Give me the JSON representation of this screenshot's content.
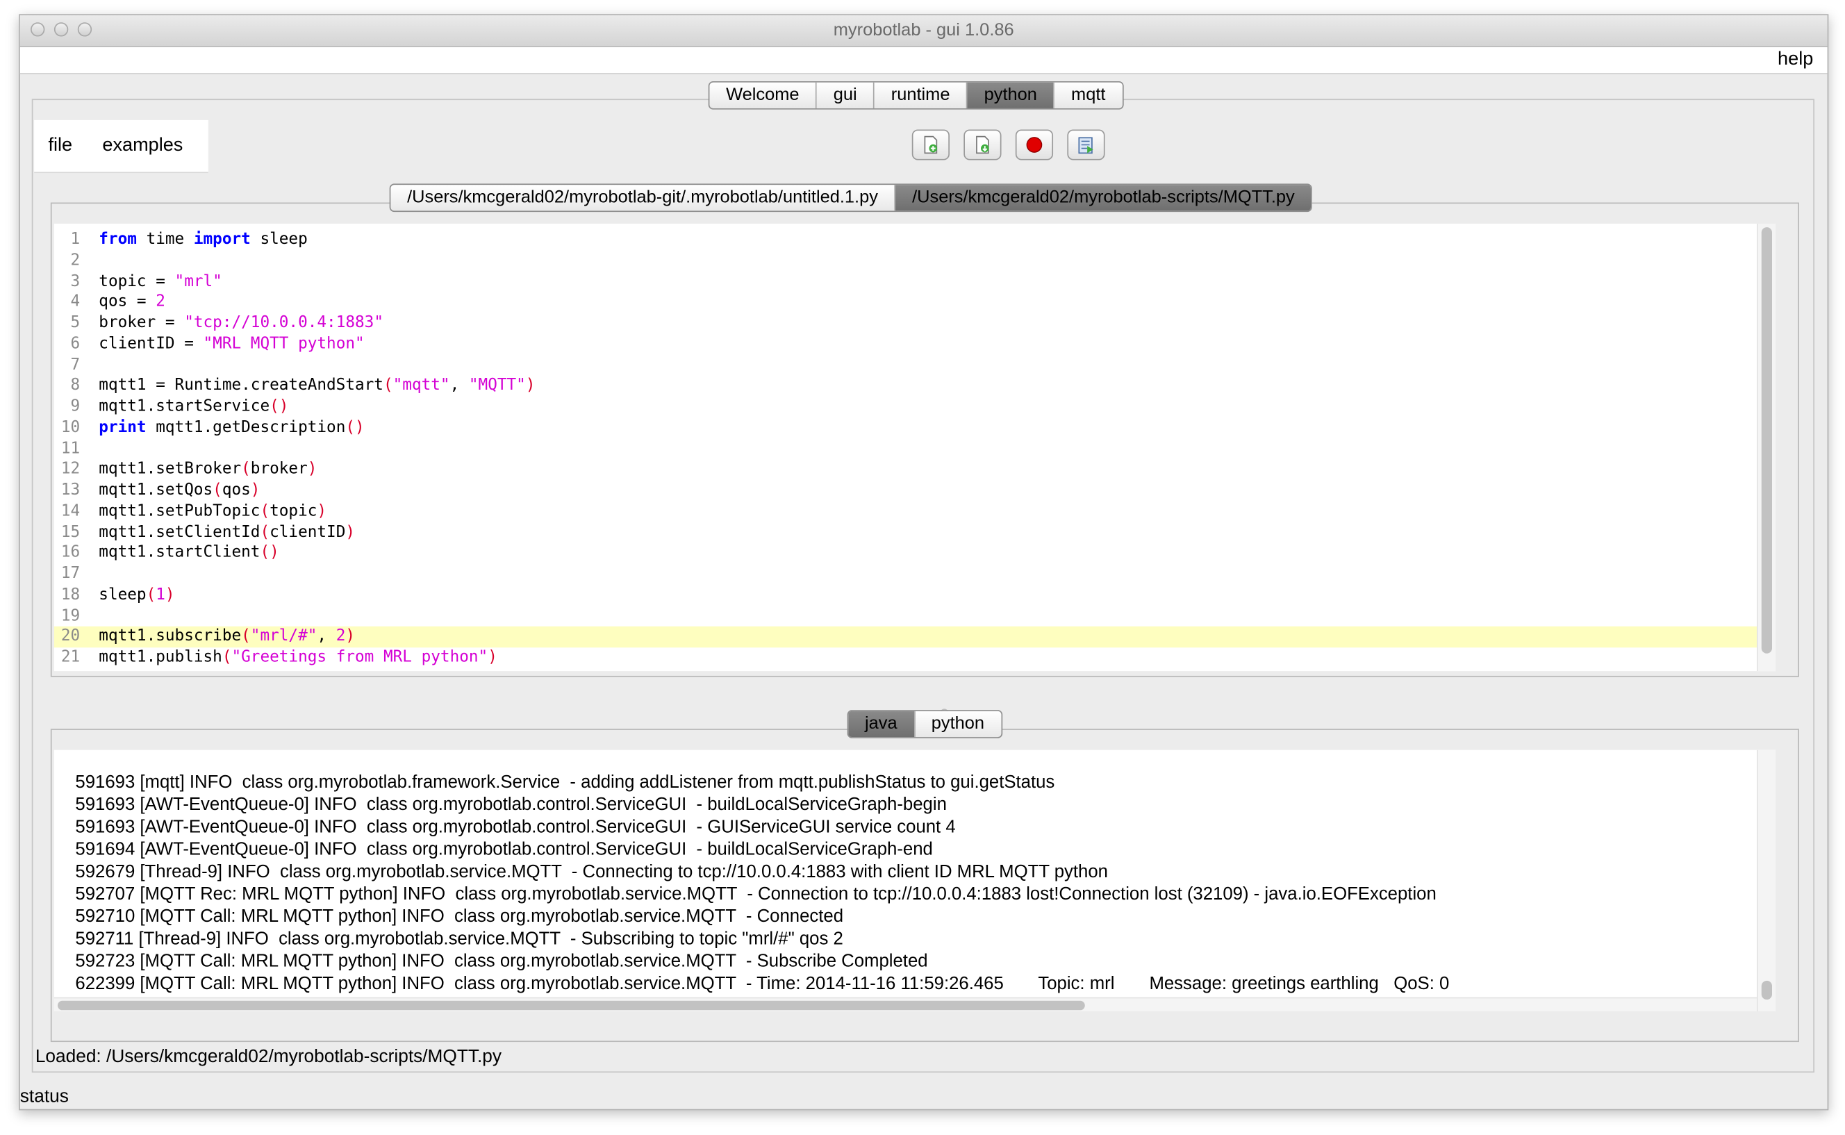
{
  "window": {
    "title": "myrobotlab - gui 1.0.86"
  },
  "menubar": {
    "help": "help"
  },
  "main_tabs": [
    {
      "label": "Welcome",
      "selected": false
    },
    {
      "label": "gui",
      "selected": false
    },
    {
      "label": "runtime",
      "selected": false
    },
    {
      "label": "python",
      "selected": true
    },
    {
      "label": "mqtt",
      "selected": false
    }
  ],
  "python_menu": {
    "file": "file",
    "examples": "examples"
  },
  "toolbar": [
    {
      "icon": "new-script-icon"
    },
    {
      "icon": "save-script-icon"
    },
    {
      "icon": "stop-icon"
    },
    {
      "icon": "execute-script-icon"
    }
  ],
  "file_tabs": [
    {
      "label": "/Users/kmcgerald02/myrobotlab-git/.myrobotlab/untitled.1.py",
      "selected": false
    },
    {
      "label": "/Users/kmcgerald02/myrobotlab-scripts/MQTT.py",
      "selected": true
    }
  ],
  "editor": {
    "highlighted_line": 20,
    "lines": [
      {
        "n": "1",
        "code": "from time import sleep"
      },
      {
        "n": "2",
        "code": ""
      },
      {
        "n": "3",
        "code": "topic = \"mrl\""
      },
      {
        "n": "4",
        "code": "qos = 2"
      },
      {
        "n": "5",
        "code": "broker = \"tcp://10.0.0.4:1883\""
      },
      {
        "n": "6",
        "code": "clientID = \"MRL MQTT python\""
      },
      {
        "n": "7",
        "code": ""
      },
      {
        "n": "8",
        "code": "mqtt1 = Runtime.createAndStart(\"mqtt\", \"MQTT\")"
      },
      {
        "n": "9",
        "code": "mqtt1.startService()"
      },
      {
        "n": "10",
        "code": "print mqtt1.getDescription()"
      },
      {
        "n": "11",
        "code": ""
      },
      {
        "n": "12",
        "code": "mqtt1.setBroker(broker)"
      },
      {
        "n": "13",
        "code": "mqtt1.setQos(qos)"
      },
      {
        "n": "14",
        "code": "mqtt1.setPubTopic(topic)"
      },
      {
        "n": "15",
        "code": "mqtt1.setClientId(clientID)"
      },
      {
        "n": "16",
        "code": "mqtt1.startClient()"
      },
      {
        "n": "17",
        "code": ""
      },
      {
        "n": "18",
        "code": "sleep(1)"
      },
      {
        "n": "19",
        "code": ""
      },
      {
        "n": "20",
        "code": "mqtt1.subscribe(\"mrl/#\", 2)"
      },
      {
        "n": "21",
        "code": "mqtt1.publish(\"Greetings from MRL python\")"
      }
    ]
  },
  "output_tabs": [
    {
      "label": "java",
      "selected": true
    },
    {
      "label": "python",
      "selected": false
    }
  ],
  "output": {
    "lines": [
      "591693 [mqtt] INFO  class org.myrobotlab.framework.Service  - adding addListener from mqtt.publishStatus to gui.getStatus",
      "591693 [AWT-EventQueue-0] INFO  class org.myrobotlab.control.ServiceGUI  - buildLocalServiceGraph-begin",
      "591693 [AWT-EventQueue-0] INFO  class org.myrobotlab.control.ServiceGUI  - GUIServiceGUI service count 4",
      "591694 [AWT-EventQueue-0] INFO  class org.myrobotlab.control.ServiceGUI  - buildLocalServiceGraph-end",
      "592679 [Thread-9] INFO  class org.myrobotlab.service.MQTT  - Connecting to tcp://10.0.0.4:1883 with client ID MRL MQTT python",
      "592707 [MQTT Rec: MRL MQTT python] INFO  class org.myrobotlab.service.MQTT  - Connection to tcp://10.0.0.4:1883 lost!Connection lost (32109) - java.io.EOFException",
      "592710 [MQTT Call: MRL MQTT python] INFO  class org.myrobotlab.service.MQTT  - Connected",
      "592711 [Thread-9] INFO  class org.myrobotlab.service.MQTT  - Subscribing to topic \"mrl/#\" qos 2",
      "592723 [MQTT Call: MRL MQTT python] INFO  class org.myrobotlab.service.MQTT  - Subscribe Completed",
      "622399 [MQTT Call: MRL MQTT python] INFO  class org.myrobotlab.service.MQTT  - Time: 2014-11-16 11:59:26.465       Topic: mrl       Message: greetings earthling   QoS: 0"
    ]
  },
  "loaded_status": "Loaded: /Users/kmcgerald02/myrobotlab-scripts/MQTT.py",
  "status": "status",
  "colors": {
    "keyword": "#0000ff",
    "string": "#d400d4",
    "paren": "#d8002a",
    "highlight": "#fefebf",
    "stop": "#e00000"
  }
}
